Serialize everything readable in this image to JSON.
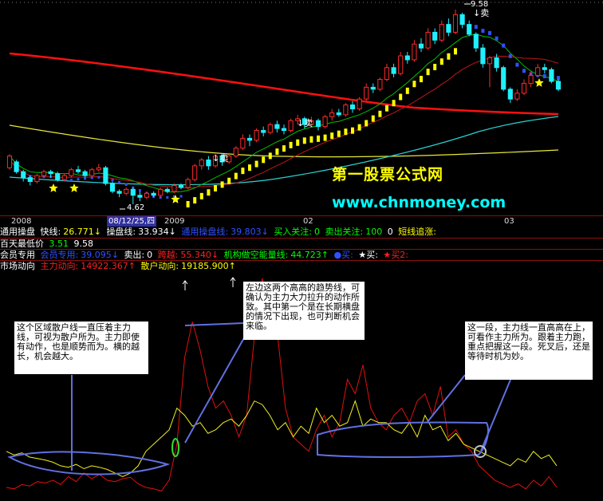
{
  "colors": {
    "background": "#000000",
    "up_candle": "#ff2a2a",
    "down_candle": "#1ff0ff",
    "ma_red": "#ff1010",
    "ma_yellow": "#e8e838",
    "ma_cyan": "#2ad0d0",
    "green_line": "#00c000",
    "blue_dots": "#3050ff",
    "yellow_blocks": "#ffff00",
    "watermark_yellow": "#ffff00",
    "watermark_cyan": "#00ffff",
    "lower_red": "#e01010",
    "lower_yellow": "#f0f020",
    "lower_blue": "#6070e0"
  },
  "dates": {
    "d1": "2008",
    "d2": "08/12/25,四",
    "d3": "2009",
    "d4": "02",
    "d5": "03"
  },
  "info1": {
    "name": "通用操盘",
    "fast_label": "快线:",
    "fast_val": "26.771↓",
    "op_label": "操盘线:",
    "op_val": "33.934↓",
    "gen_label": "通用操盘线:",
    "gen_val": "39.803↓",
    "buy_label": "买入关注:",
    "buy_val": "0",
    "sell_label": "卖出关注:",
    "sell_val": "100",
    "zero": "0",
    "short_label": "短线追涨:"
  },
  "info2": {
    "name": "百天最低价",
    "v1": "3.51",
    "v2": "9.58"
  },
  "info3": {
    "name": "会员专用",
    "main_label": "会员专用:",
    "main_val": "39.095↓",
    "sell_label": "卖出:",
    "sell_val": "0",
    "jump_label": "跨越:",
    "jump_val": "55.340↓",
    "inst_label": "机构做空能量线:",
    "inst_val": "44.723↑",
    "buy_label": "●买:",
    "star_buy_label": "★买:",
    "star_buy2_label": "★买2:"
  },
  "info4": {
    "name": "市场动向",
    "main_label": "主力动向:",
    "main_val": "14922.367↑",
    "retail_label": "散户动向:",
    "retail_val": "19185.900↑"
  },
  "annotations": {
    "high": "9.58",
    "low": "4.62",
    "sell1": "↓卖",
    "sell2": "↓卖",
    "sell3": "↓卖"
  },
  "watermark": {
    "line1": "第一股票公式网",
    "line2": "www.chnmoney.com"
  },
  "notes": {
    "n1": "这个区域散户线一直压着主力线，可视为散户所为。主力即使有动作，也是顺势而为。横的越长，机会越大。",
    "n2": "左边这两个高高的趋势线，可确认为主力大力拉升的动作所致。其中第一个是在长期横盘的情况下出现，也可判断机会来临。",
    "n3": "这一段，主力线一直高高在上，可看作主力所为。跟着主力跑，重点把握这一段。死叉后，还是等待时机为妙。"
  },
  "chart_data": [
    {
      "type": "candlestick",
      "title": "",
      "x_ticks": [
        "2008",
        "08/12/25,四",
        "2009",
        "02",
        "03"
      ],
      "annotations": {
        "high": 9.58,
        "low": 4.62
      },
      "candles": [
        [
          5.55,
          5.85,
          5.5,
          5.9
        ],
        [
          5.7,
          5.45,
          5.4,
          5.75
        ],
        [
          5.45,
          5.3,
          5.2,
          5.5
        ],
        [
          5.3,
          5.2,
          5.1,
          5.35
        ],
        [
          5.2,
          5.35,
          5.15,
          5.4
        ],
        [
          5.35,
          5.45,
          5.3,
          5.5
        ],
        [
          5.45,
          5.4,
          5.3,
          5.5
        ],
        [
          5.4,
          5.25,
          5.2,
          5.45
        ],
        [
          5.25,
          5.35,
          5.2,
          5.4
        ],
        [
          5.35,
          5.5,
          5.3,
          5.55
        ],
        [
          5.5,
          5.45,
          5.4,
          5.6
        ],
        [
          5.45,
          5.35,
          5.3,
          5.5
        ],
        [
          5.35,
          5.5,
          5.3,
          5.55
        ],
        [
          5.5,
          5.55,
          5.45,
          5.65
        ],
        [
          5.55,
          5.15,
          5.1,
          5.6
        ],
        [
          5.15,
          4.95,
          4.9,
          5.2
        ],
        [
          4.95,
          4.9,
          4.8,
          5.0
        ],
        [
          4.9,
          5.0,
          4.85,
          5.05
        ],
        [
          5.0,
          4.85,
          4.62,
          5.05
        ],
        [
          4.85,
          4.8,
          4.7,
          4.95
        ],
        [
          4.8,
          4.9,
          4.75,
          4.95
        ],
        [
          4.9,
          4.85,
          4.8,
          4.95
        ],
        [
          4.85,
          5.0,
          4.8,
          5.05
        ],
        [
          5.0,
          4.95,
          4.9,
          5.05
        ],
        [
          4.95,
          5.1,
          4.9,
          5.15
        ],
        [
          5.1,
          5.05,
          5.0,
          5.15
        ],
        [
          5.05,
          5.25,
          5.0,
          5.3
        ],
        [
          5.25,
          5.6,
          5.2,
          5.65
        ],
        [
          5.6,
          5.75,
          5.5,
          5.8
        ],
        [
          5.75,
          5.6,
          5.5,
          5.85
        ],
        [
          5.6,
          5.85,
          5.55,
          5.9
        ],
        [
          5.85,
          5.7,
          5.6,
          5.9
        ],
        [
          5.7,
          5.85,
          5.65,
          5.9
        ],
        [
          5.85,
          6.05,
          5.8,
          6.1
        ],
        [
          6.05,
          6.3,
          6.0,
          6.4
        ],
        [
          6.3,
          6.25,
          6.1,
          6.4
        ],
        [
          6.25,
          6.5,
          6.2,
          6.55
        ],
        [
          6.5,
          6.45,
          6.35,
          6.6
        ],
        [
          6.45,
          6.65,
          6.4,
          6.7
        ],
        [
          6.65,
          6.55,
          6.45,
          6.75
        ],
        [
          6.55,
          6.5,
          6.4,
          6.65
        ],
        [
          6.5,
          6.75,
          6.45,
          6.8
        ],
        [
          6.75,
          6.8,
          6.65,
          6.9
        ],
        [
          6.8,
          6.65,
          6.55,
          6.85
        ],
        [
          6.65,
          6.75,
          6.6,
          6.85
        ],
        [
          6.75,
          6.6,
          6.5,
          6.8
        ],
        [
          6.6,
          6.85,
          6.55,
          6.9
        ],
        [
          6.85,
          6.95,
          6.75,
          7.05
        ],
        [
          6.95,
          6.9,
          6.85,
          7.05
        ],
        [
          6.9,
          7.15,
          6.85,
          7.2
        ],
        [
          7.15,
          7.05,
          6.95,
          7.25
        ],
        [
          7.05,
          7.3,
          7.0,
          7.35
        ],
        [
          7.3,
          7.6,
          7.25,
          7.7
        ],
        [
          7.6,
          7.55,
          7.45,
          7.7
        ],
        [
          7.55,
          7.8,
          7.5,
          7.85
        ],
        [
          7.8,
          8.1,
          7.75,
          8.2
        ],
        [
          8.1,
          7.95,
          7.85,
          8.2
        ],
        [
          7.95,
          8.4,
          7.9,
          8.5
        ],
        [
          8.4,
          8.3,
          8.2,
          8.5
        ],
        [
          8.3,
          8.7,
          8.25,
          8.8
        ],
        [
          8.7,
          8.6,
          8.5,
          8.85
        ],
        [
          8.6,
          9.0,
          8.55,
          9.1
        ],
        [
          9.0,
          8.8,
          8.7,
          9.1
        ],
        [
          8.8,
          9.2,
          8.75,
          9.3
        ],
        [
          9.2,
          9.0,
          8.9,
          9.35
        ],
        [
          9.0,
          9.45,
          8.95,
          9.58
        ],
        [
          9.45,
          9.2,
          9.1,
          9.5
        ],
        [
          9.2,
          8.95,
          8.9,
          9.3
        ],
        [
          8.95,
          8.6,
          8.5,
          9.0
        ],
        [
          8.6,
          8.2,
          8.1,
          8.7
        ],
        [
          8.2,
          8.35,
          7.6,
          8.4
        ],
        [
          8.35,
          8.1,
          8.0,
          8.45
        ],
        [
          8.1,
          7.55,
          7.5,
          8.15
        ],
        [
          7.55,
          7.3,
          7.2,
          7.6
        ],
        [
          7.3,
          7.45,
          7.25,
          7.55
        ],
        [
          7.45,
          7.7,
          7.4,
          7.8
        ],
        [
          7.7,
          7.9,
          7.6,
          8.0
        ],
        [
          7.9,
          8.1,
          7.85,
          8.2
        ],
        [
          8.1,
          8.05,
          7.95,
          8.2
        ],
        [
          8.05,
          7.75,
          7.7,
          8.1
        ],
        [
          7.75,
          7.55,
          7.5,
          7.8
        ]
      ]
    },
    {
      "type": "line",
      "title": "",
      "series": [
        {
          "name": "主力动向",
          "values": [
            10,
            8,
            14,
            12,
            18,
            16,
            20,
            14,
            25,
            18,
            30,
            22,
            28,
            20,
            18,
            22,
            24,
            15,
            10,
            8,
            5,
            20,
            70,
            190,
            240,
            200,
            150,
            120,
            130,
            110,
            80,
            110,
            220,
            300,
            260,
            220,
            120,
            80,
            70,
            60,
            90,
            110,
            80,
            100,
            160,
            140,
            180,
            120,
            100,
            90,
            110,
            120,
            100,
            130,
            140,
            110,
            150,
            80,
            90,
            70,
            60,
            40,
            30,
            20,
            15,
            10,
            15,
            8,
            20,
            12,
            25,
            10
          ]
        },
        {
          "name": "散户动向",
          "values": [
            60,
            55,
            58,
            52,
            50,
            48,
            45,
            40,
            38,
            42,
            36,
            40,
            38,
            35,
            30,
            25,
            30,
            40,
            60,
            70,
            80,
            90,
            120,
            110,
            95,
            100,
            85,
            90,
            100,
            105,
            95,
            110,
            130,
            125,
            110,
            90,
            100,
            80,
            95,
            85,
            120,
            100,
            110,
            95,
            100,
            130,
            95,
            105,
            100,
            100,
            90,
            85,
            100,
            80,
            110,
            90,
            95,
            75,
            85,
            70,
            65,
            60,
            55,
            50,
            45,
            40,
            50,
            45,
            60,
            50,
            55,
            40
          ]
        }
      ]
    }
  ]
}
